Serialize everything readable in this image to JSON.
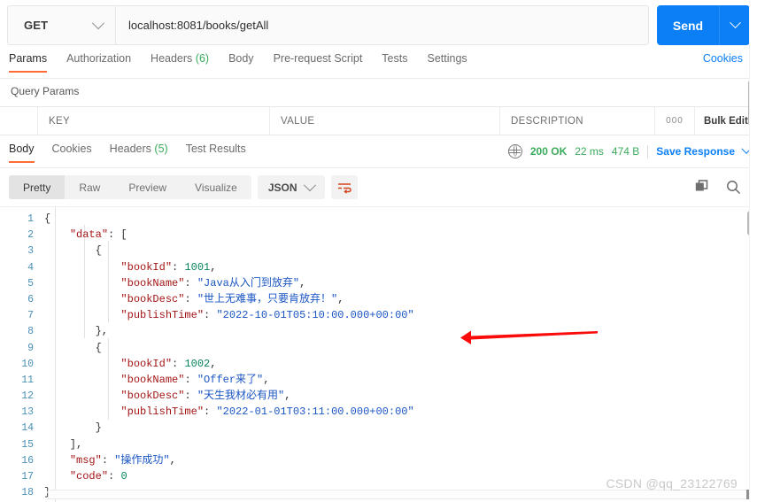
{
  "request": {
    "method": "GET",
    "url": "localhost:8081/books/getAll",
    "send_label": "Send",
    "tabs": [
      {
        "label": "Params",
        "active": true,
        "count": ""
      },
      {
        "label": "Authorization",
        "active": false,
        "count": ""
      },
      {
        "label": "Headers",
        "active": false,
        "count": "(6)"
      },
      {
        "label": "Body",
        "active": false,
        "count": ""
      },
      {
        "label": "Pre-request Script",
        "active": false,
        "count": ""
      },
      {
        "label": "Tests",
        "active": false,
        "count": ""
      },
      {
        "label": "Settings",
        "active": false,
        "count": ""
      }
    ],
    "cookies_link": "Cookies"
  },
  "query_params": {
    "title": "Query Params",
    "columns": [
      "KEY",
      "VALUE",
      "DESCRIPTION"
    ],
    "more_dots": "000",
    "bulk_edit": "Bulk Edit"
  },
  "response": {
    "tabs": [
      {
        "label": "Body",
        "active": true,
        "count": ""
      },
      {
        "label": "Cookies",
        "active": false,
        "count": ""
      },
      {
        "label": "Headers",
        "active": false,
        "count": "(5)"
      },
      {
        "label": "Test Results",
        "active": false,
        "count": ""
      }
    ],
    "status": "200 OK",
    "time": "22 ms",
    "size": "474 B",
    "save_response": "Save Response",
    "format_tabs": [
      {
        "label": "Pretty",
        "active": true
      },
      {
        "label": "Raw",
        "active": false
      },
      {
        "label": "Preview",
        "active": false
      },
      {
        "label": "Visualize",
        "active": false
      }
    ],
    "language": "JSON"
  },
  "body_json": {
    "lines": [
      {
        "no": "1",
        "text": "{"
      },
      {
        "no": "2",
        "text": "    \"data\": ["
      },
      {
        "no": "3",
        "text": "        {"
      },
      {
        "no": "4",
        "text": "            \"bookId\": 1001,"
      },
      {
        "no": "5",
        "text": "            \"bookName\": \"Java从入门到放弃\","
      },
      {
        "no": "6",
        "text": "            \"bookDesc\": \"世上无难事，只要肯放弃！\","
      },
      {
        "no": "7",
        "text": "            \"publishTime\": \"2022-10-01T05:10:00.000+00:00\""
      },
      {
        "no": "8",
        "text": "        },"
      },
      {
        "no": "9",
        "text": "        {"
      },
      {
        "no": "10",
        "text": "            \"bookId\": 1002,"
      },
      {
        "no": "11",
        "text": "            \"bookName\": \"Offer来了\","
      },
      {
        "no": "12",
        "text": "            \"bookDesc\": \"天生我材必有用\","
      },
      {
        "no": "13",
        "text": "            \"publishTime\": \"2022-01-01T03:11:00.000+00:00\""
      },
      {
        "no": "14",
        "text": "        }"
      },
      {
        "no": "15",
        "text": "    ],"
      },
      {
        "no": "16",
        "text": "    \"msg\": \"操作成功\","
      },
      {
        "no": "17",
        "text": "    \"code\": 0"
      },
      {
        "no": "18",
        "text": "}"
      }
    ],
    "parsed": {
      "data": [
        {
          "bookId": 1001,
          "bookName": "Java从入门到放弃",
          "bookDesc": "世上无难事，只要肯放弃！",
          "publishTime": "2022-10-01T05:10:00.000+00:00"
        },
        {
          "bookId": 1002,
          "bookName": "Offer来了",
          "bookDesc": "天生我材必有用",
          "publishTime": "2022-01-01T03:11:00.000+00:00"
        }
      ],
      "msg": "操作成功",
      "code": 0
    }
  },
  "annotation": {
    "arrow_color": "#fb0a0a",
    "direction": "left"
  },
  "watermark": "CSDN @qq_23122769",
  "colors": {
    "accent_orange": "#ff6c37",
    "link_blue": "#0b7ff5",
    "status_green": "#3bab5c"
  }
}
